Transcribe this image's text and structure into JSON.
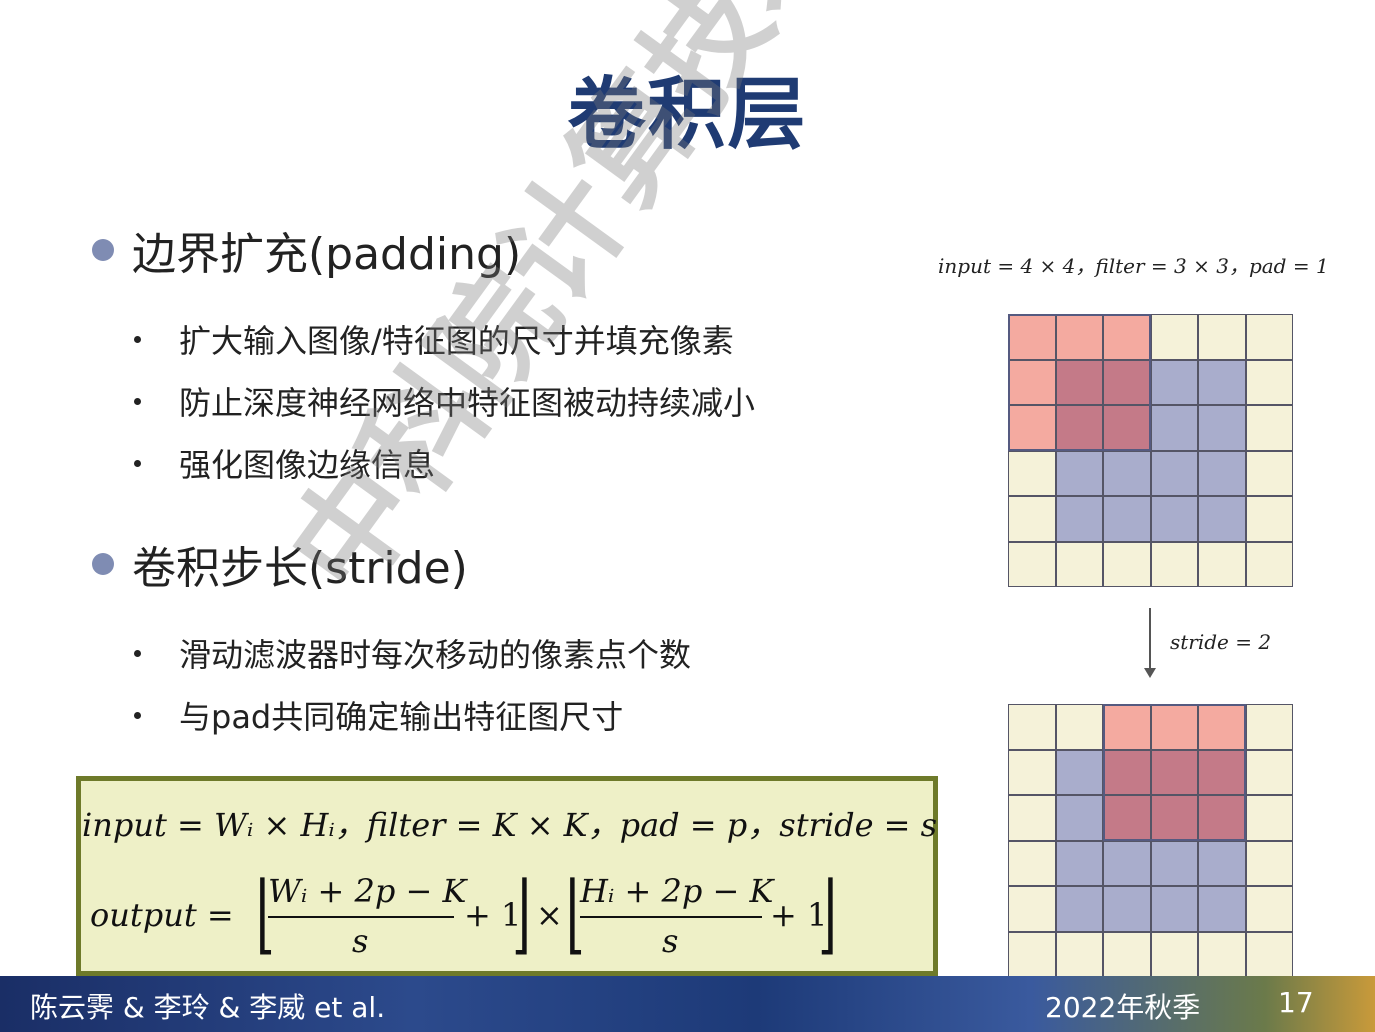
{
  "title": "卷积层",
  "sections": [
    {
      "heading": "边界扩充(padding)",
      "items": [
        "扩大输入图像/特征图的尺寸并填充像素",
        "防止深度神经网络中特征图被动持续减小",
        "强化图像边缘信息"
      ]
    },
    {
      "heading": "卷积步长(stride)",
      "items": [
        "滑动滤波器时每次移动的像素点个数",
        "与pad共同确定输出特征图尺寸"
      ]
    }
  ],
  "annotation_top": "input = 4 × 4，filter = 3 × 3，pad = 1",
  "annotation_stride": "stride = 2",
  "formula": {
    "line1": "input = Wᵢ × Hᵢ，filter = K × K，pad = p，stride = s",
    "output_label": "output =",
    "frac1_num": "Wᵢ + 2p − K",
    "frac2_num": "Hᵢ + 2p − K",
    "denom": "s",
    "plus_one": "+ 1",
    "times": "×"
  },
  "footer": {
    "authors": "陈云霁 & 李玲 & 李威 et al.",
    "term": "2022年秋季",
    "page": "17"
  },
  "watermark": "中科院计算技术研究所",
  "colors": {
    "title": "#1f3b73",
    "pad_cell": "#f5f2d9",
    "input_cell": "#a9adcc",
    "filter_cell": "#f4aaa0",
    "overlap_cell": "#c47a88",
    "formula_bg": "#eef0c7",
    "formula_border": "#6e7a2a"
  }
}
